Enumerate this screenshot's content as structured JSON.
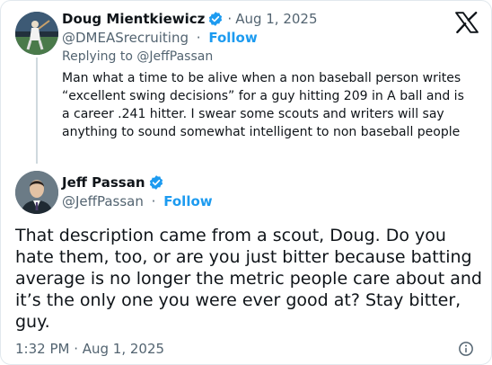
{
  "reply": {
    "author_name": "Doug Mientkiewicz",
    "date": "Aug 1, 2025",
    "handle": "@DMEASrecruiting",
    "follow_label": "Follow",
    "replying_to": "Replying to @JeffPassan",
    "text": "Man what a time to be alive when a non baseball person writes “excellent swing decisions” for a guy hitting 209 in A ball and is a career .241 hitter. I swear some scouts and writers will say anything to sound somewhat intelligent to non baseball people"
  },
  "tweet": {
    "author_name": "Jeff Passan",
    "handle": "@JeffPassan",
    "follow_label": "Follow",
    "text": "That description came from a scout, Doug. Do you hate them, too, or are you just bitter because batting average is no longer the metric people care about and it’s the only one you were ever good at? Stay bitter, guy.",
    "timestamp": "1:32 PM · Aug 1, 2025"
  },
  "separator": "·",
  "colors": {
    "link": "#1d9bf0",
    "secondary_text": "#536471",
    "verified": "#1d9bf0"
  },
  "icons": [
    "x-logo-icon",
    "verified-badge-icon",
    "info-icon"
  ]
}
